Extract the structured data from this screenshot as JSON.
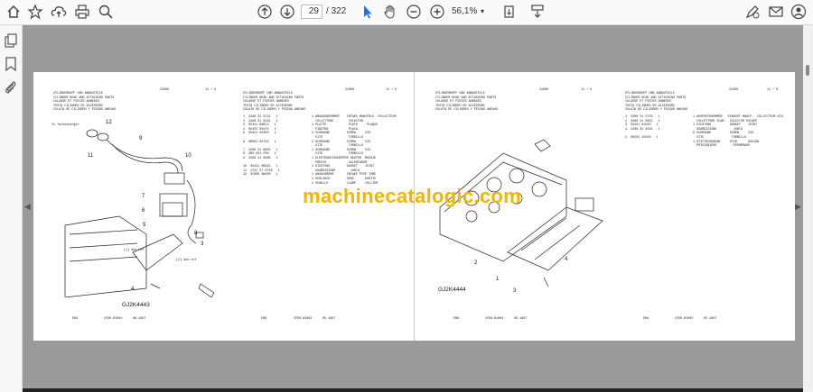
{
  "toolbar": {
    "current_page": "29",
    "page_separator": "/",
    "total_pages": "322",
    "zoom": "56,1%"
  },
  "left_page": {
    "header_code": "31080",
    "header_sheet": "11 / 8",
    "diagram_id": "GJ2K4443",
    "callouts": [
      "12",
      "11",
      "9",
      "10",
      "7",
      "6",
      "5",
      "8",
      "3",
      "4"
    ],
    "footer": [
      "ENG",
      "CPD0-B1004",
      "08-1987"
    ],
    "notes": [
      "To Turbocharger",
      "[1] See ref",
      "[2] See ref"
    ]
  },
  "center_page": {
    "header_code": "31080",
    "header_sheet": "11 / 8",
    "footer": [
      "ENG",
      "CPD0-B1002",
      "05-1987"
    ]
  },
  "right_page": {
    "header_code": "31080",
    "header_sheet": "11 / 8",
    "diagram_id": "GJ2K4444",
    "callouts": [
      "2",
      "4",
      "1",
      "3"
    ],
    "footer": [
      "ENG",
      "CPD0-B1004",
      "08-1987"
    ]
  },
  "far_right_page": {
    "header_code": "31080",
    "header_sheet": "11 / 8",
    "footer": [
      "ENG",
      "CPD0-B1002",
      "05-1987"
    ]
  },
  "watermark": "machinecatalogic.com",
  "colors": {
    "watermark": "#f5b400",
    "viewer_bg": "#9a9a9a"
  }
}
